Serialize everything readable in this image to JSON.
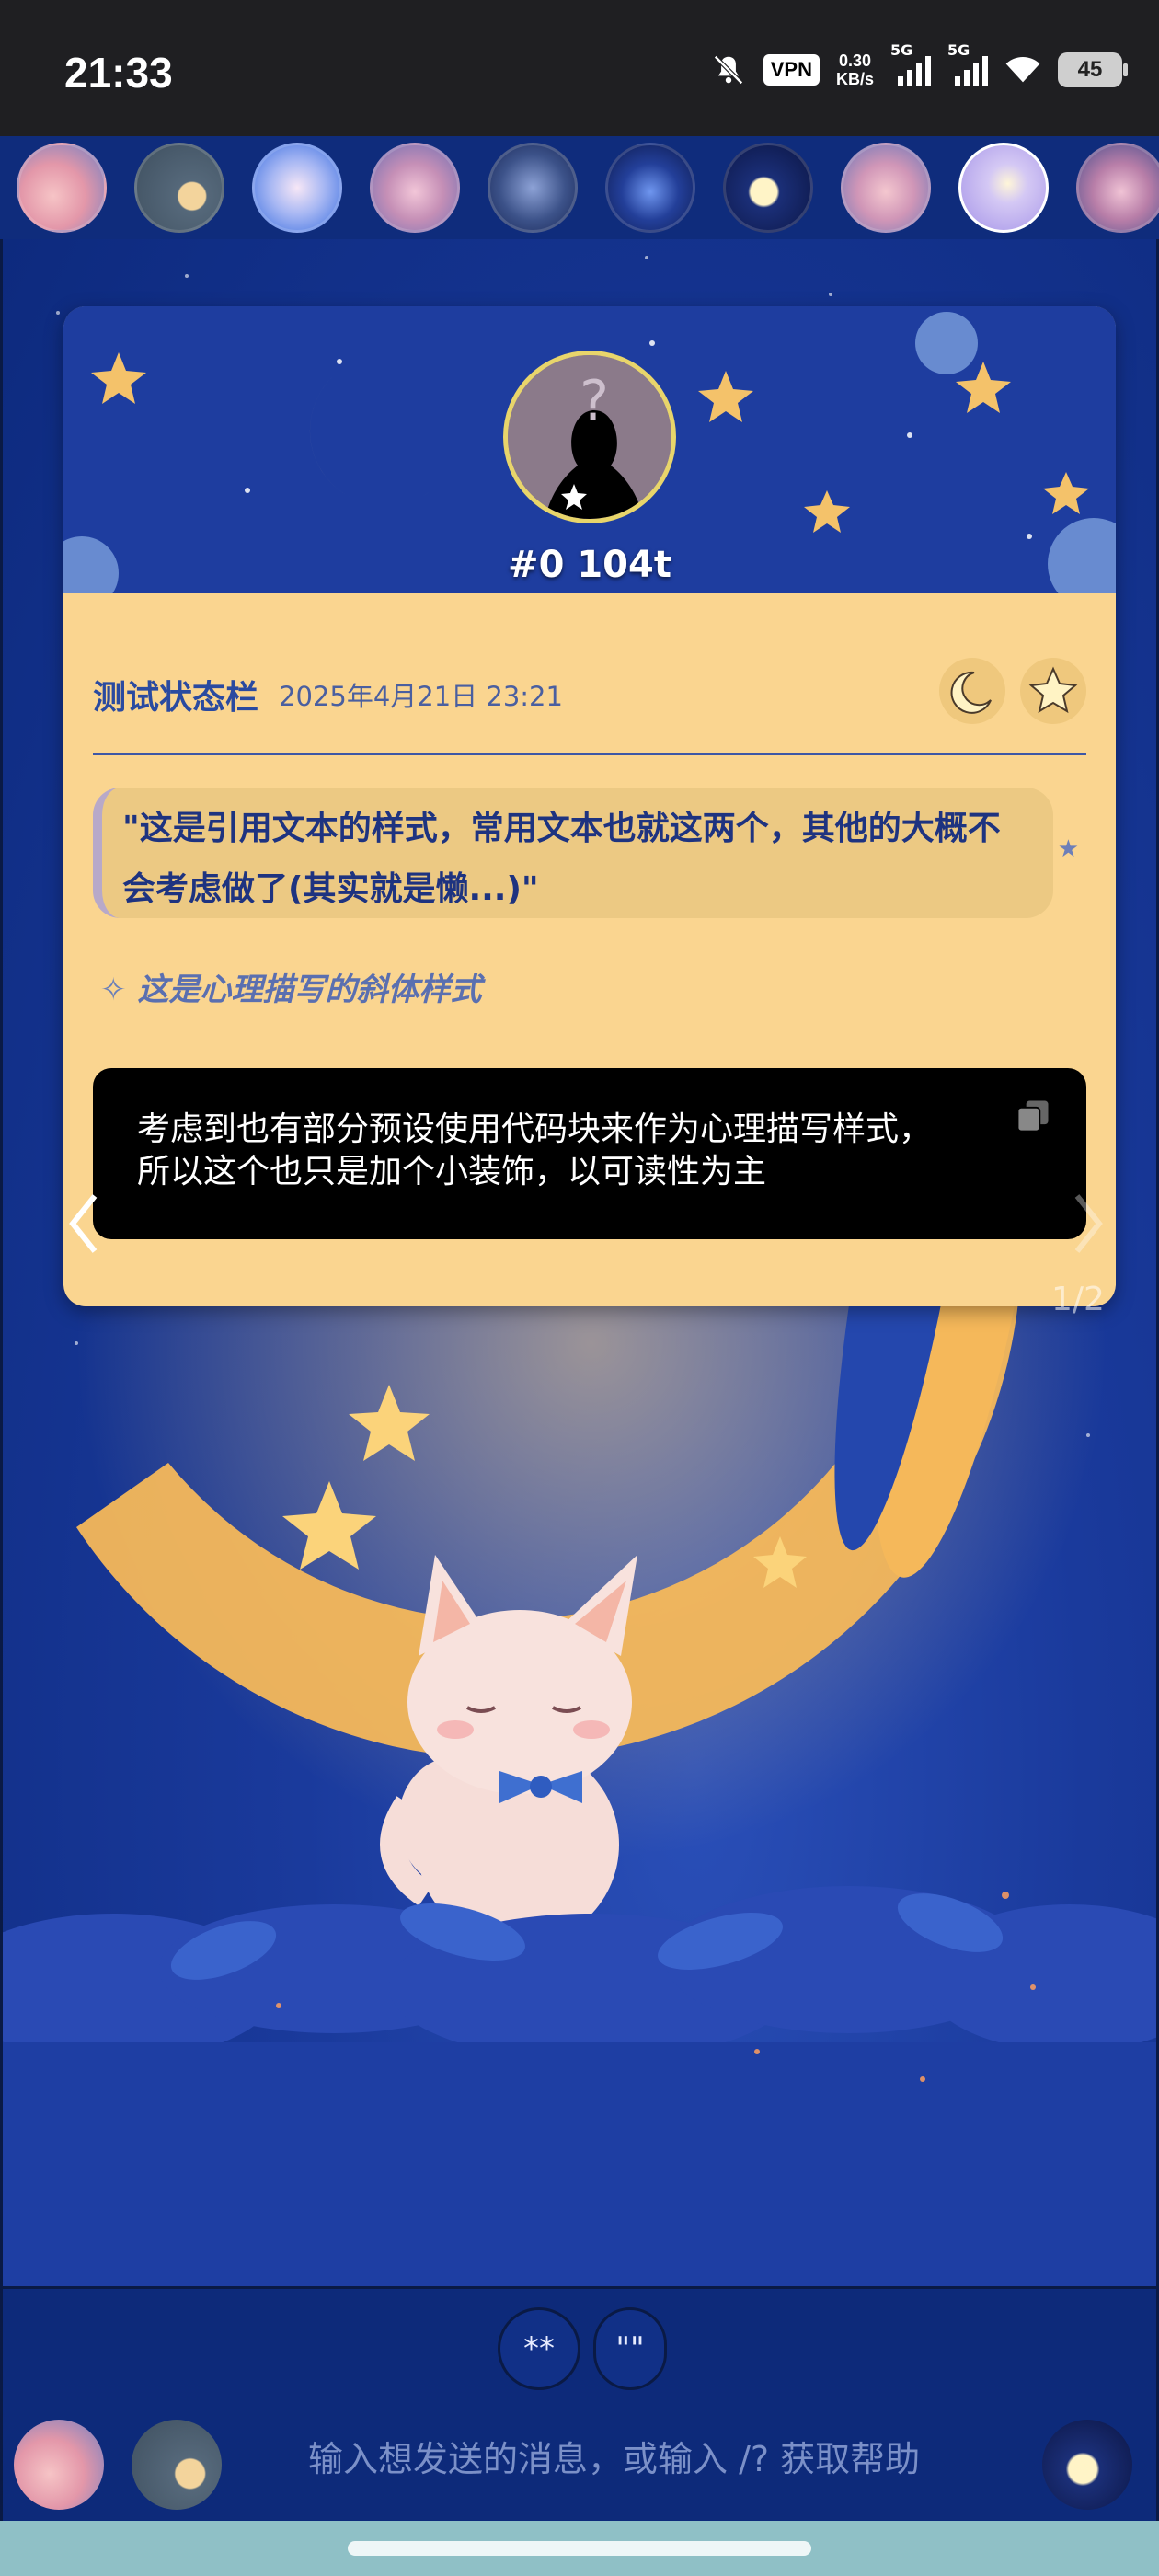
{
  "status_bar": {
    "time": "21:33",
    "vpn": "VPN",
    "speed_value": "0.30",
    "speed_unit": "KB/s",
    "sim1": "5G",
    "sim2": "5G",
    "battery": "45",
    "icons": [
      "mute-bell-icon",
      "vpn-icon",
      "signal-icon",
      "signal-icon",
      "wifi-icon",
      "battery-icon"
    ]
  },
  "avatar_strip": {
    "count": 10
  },
  "card": {
    "tag": "#0 104t",
    "character_name": "测试状态栏",
    "timestamp": "2025年4月21日 23:21",
    "quote": "\"这是引用文本的样式，常用文本也就这两个，其他的大概不会考虑做了(其实就是懒...)\"",
    "inner_thought": "这是心理描写的斜体样式",
    "inner_thought_icon": "✧",
    "code_line1": "考虑到也有部分预设使用代码块来作为心理描写样式，",
    "code_line2": "所以这个也只是加个小装饰，以可读性为主",
    "pager": "1/2"
  },
  "input": {
    "quick_bold": "**",
    "quick_quote": "\"\"",
    "placeholder": "输入想发送的消息，或输入 /? 获取帮助"
  },
  "colors": {
    "card_bg": "#fad590",
    "accent_blue": "#2a4aa0",
    "background": "#0d2a7e"
  }
}
